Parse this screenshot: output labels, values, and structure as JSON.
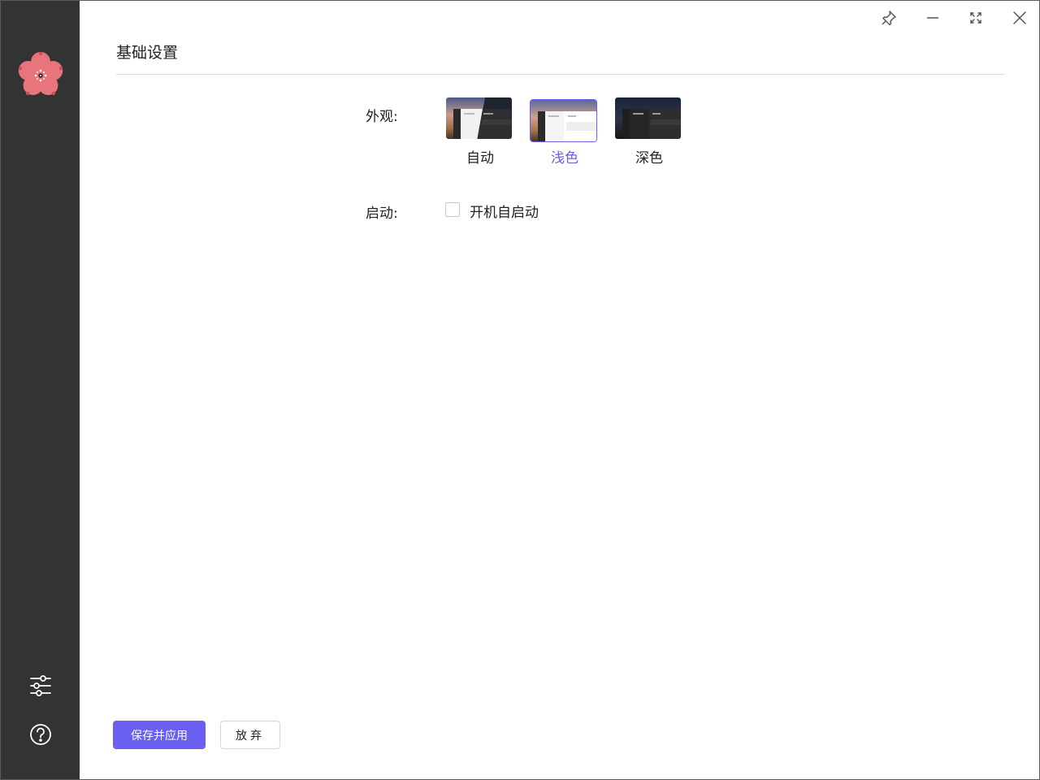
{
  "page": {
    "title": "基础设置"
  },
  "window_controls": {
    "pin_icon": "pin-icon",
    "minimize_icon": "minimize-icon",
    "maximize_icon": "maximize-icon",
    "close_icon": "close-icon"
  },
  "appearance": {
    "label": "外观:",
    "options": [
      {
        "label": "自动",
        "theme": "auto",
        "selected": false
      },
      {
        "label": "浅色",
        "theme": "light",
        "selected": true
      },
      {
        "label": "深色",
        "theme": "dark",
        "selected": false
      }
    ]
  },
  "startup": {
    "label": "启动:",
    "checkbox_label": "开机自启动",
    "checked": false
  },
  "actions": {
    "save_label": "保存并应用",
    "discard_label": "放弃"
  },
  "sidebar": {
    "logo_icon": "cherry-blossom-logo-icon",
    "settings_icon": "sliders-icon",
    "help_icon": "help-icon"
  },
  "colors": {
    "accent": "#6a5ff0",
    "sidebar": "#333333",
    "logo": "#e8747c"
  }
}
